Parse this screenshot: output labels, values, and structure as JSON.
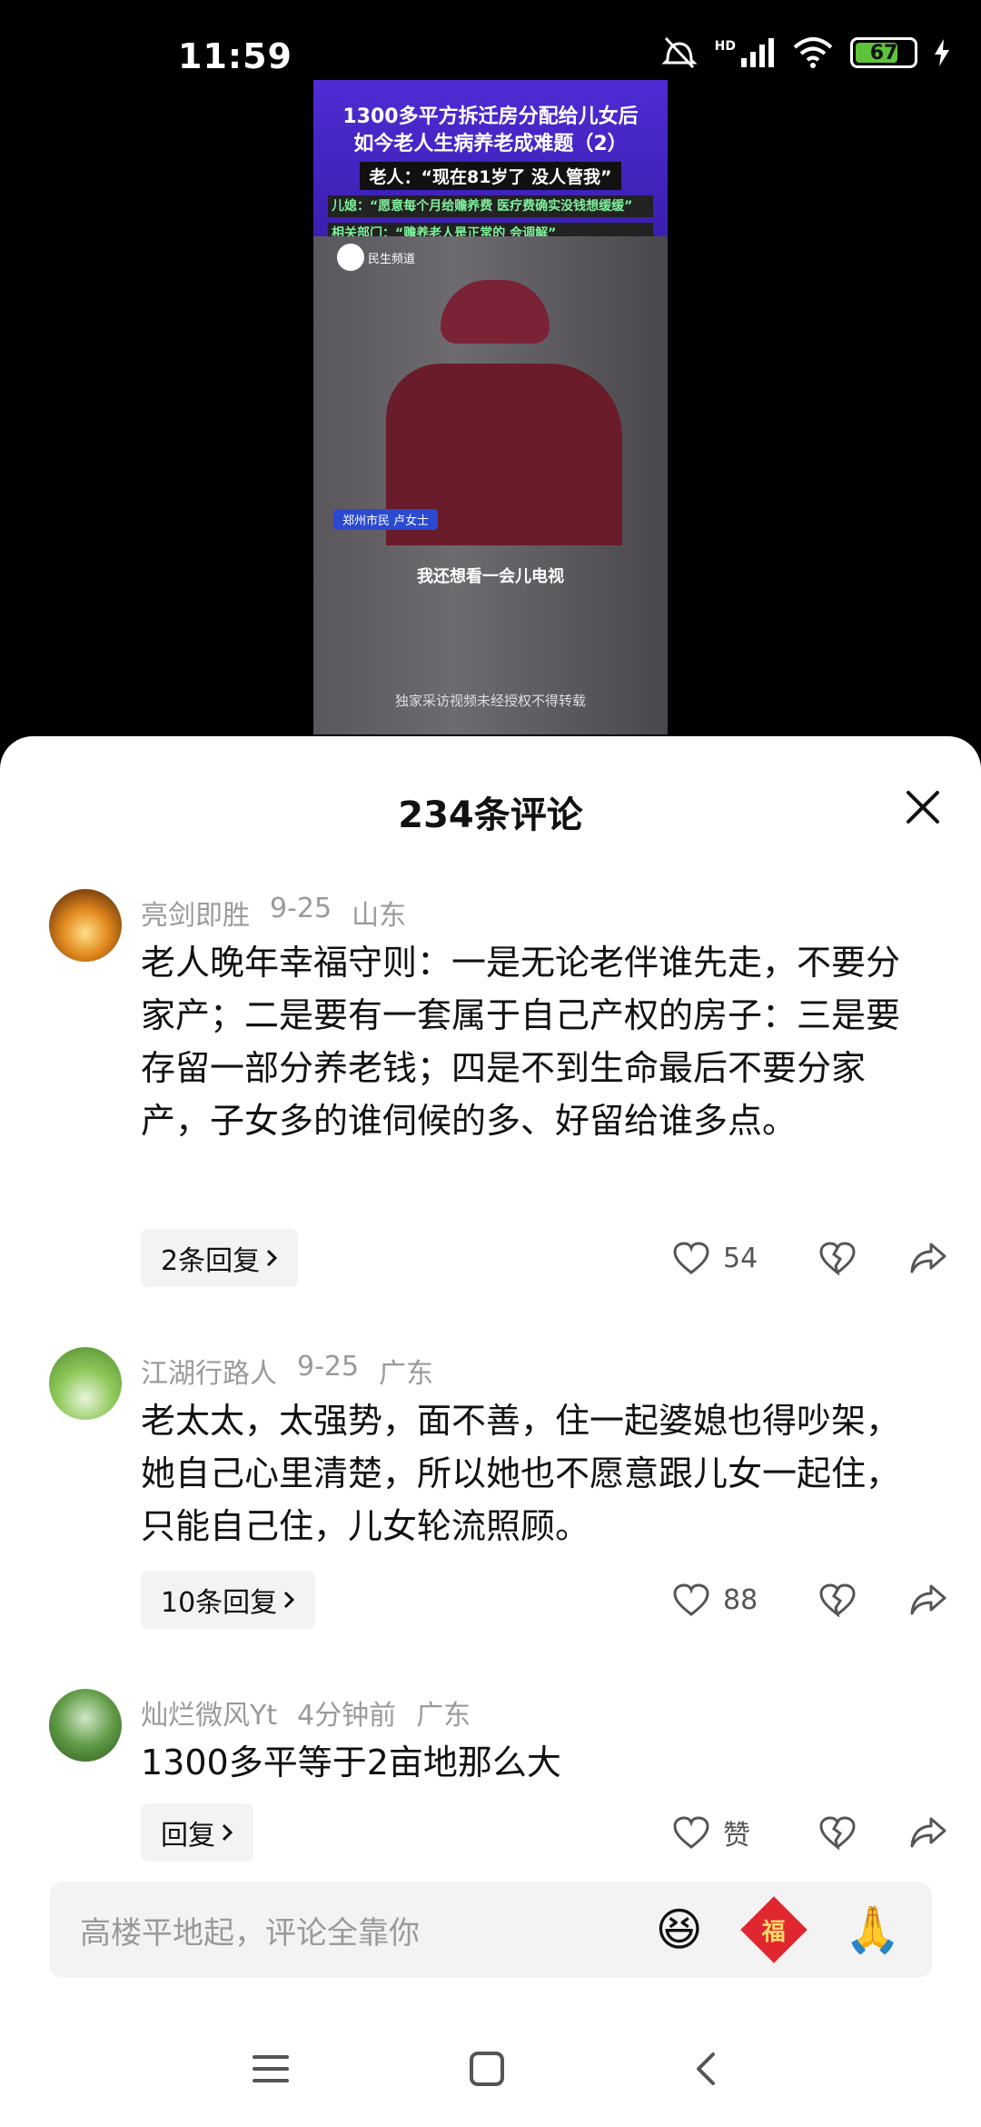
{
  "status_bar": {
    "time": "11:59",
    "battery": "67",
    "network": "HD"
  },
  "video": {
    "title_line1": "1300多平方拆迁房分配给儿女后",
    "title_line2": "如今老人生病养老成难题（2）",
    "subtitle": "老人：“现在81岁了 没人管我”",
    "quote1": "儿媳：“愿意每个月给赡养费 医疗费确实没钱想缓缓”",
    "quote2": "相关部门：“赡养老人是正常的 会调解”",
    "channel": "民生频道",
    "location_tag": "郑州市民 卢女士",
    "caption": "我还想看一会儿电视",
    "watermark": "独家采访视频未经授权不得转载"
  },
  "comments_panel": {
    "title": "234条评论",
    "comments": [
      {
        "user": "亮剑即胜",
        "date": "9-25",
        "region": "山东",
        "text": "老人晚年幸福守则：一是无论老伴谁先走，不要分家产；二是要有一套属于自己产权的房子：三是要存留一部分养老钱；四是不到生命最后不要分家产，子女多的谁伺候的多、好留给谁多点。",
        "replies": "2条回复",
        "likes": "54"
      },
      {
        "user": "江湖行路人",
        "date": "9-25",
        "region": "广东",
        "text": "老太太，太强势，面不善，住一起婆媳也得吵架，她自己心里清楚，所以她也不愿意跟儿女一起住，只能自己住，儿女轮流照顾。",
        "replies": "10条回复",
        "likes": "88"
      },
      {
        "user": "灿烂微风Yt",
        "date": "4分钟前",
        "region": "广东",
        "text": "1300多平等于2亩地那么大",
        "replies": "回复",
        "likes": "赞"
      }
    ]
  },
  "input": {
    "placeholder": "高楼平地起，评论全靠你",
    "emoji1": "😆",
    "fu": "福",
    "emoji2": "🙏"
  },
  "colors": {
    "accent_red": "#e0262e",
    "banner_purple": "#4f2bd4",
    "muted": "#9a9a9a"
  }
}
